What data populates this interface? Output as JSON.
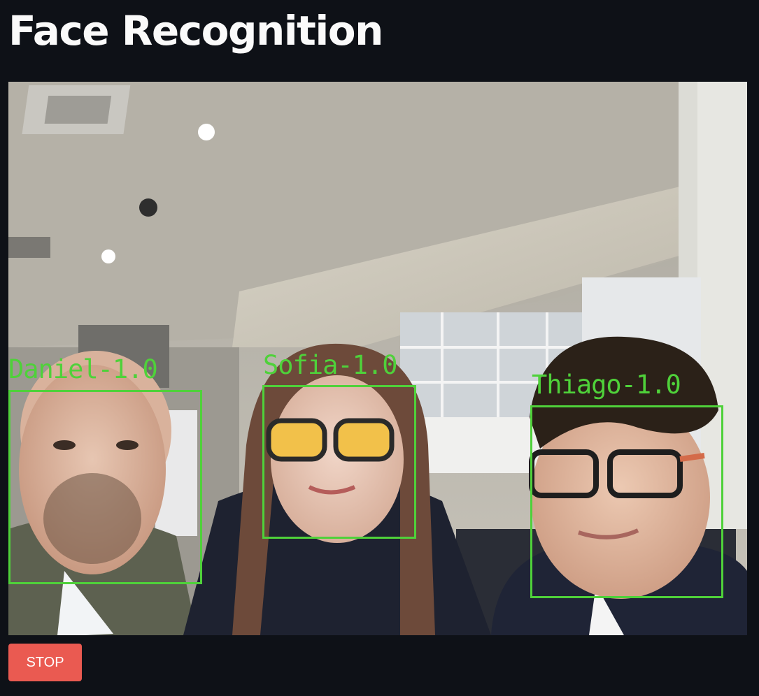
{
  "page": {
    "title": "Face Recognition"
  },
  "video": {
    "detections": [
      {
        "label": "Daniel-1.0"
      },
      {
        "label": "Sofia-1.0"
      },
      {
        "label": "Thiago-1.0"
      }
    ],
    "box_color": "#4fd13a"
  },
  "controls": {
    "stop_label": "STOP",
    "stop_color": "#ea5a51"
  },
  "theme": {
    "background": "#0e1117",
    "text": "#fafafa"
  }
}
